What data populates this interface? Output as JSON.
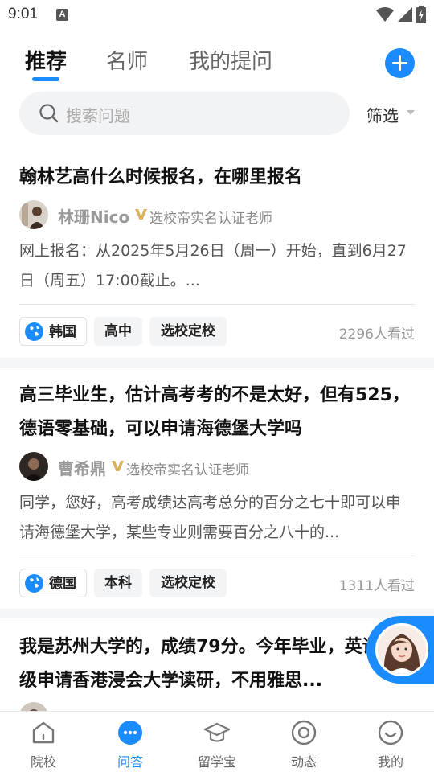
{
  "status_bar": {
    "time": "9:01",
    "notification_badge": "A"
  },
  "tabs": [
    {
      "label": "推荐",
      "active": true
    },
    {
      "label": "名师",
      "active": false
    },
    {
      "label": "我的提问",
      "active": false
    }
  ],
  "search": {
    "placeholder": "搜索问题",
    "filter_label": "筛选"
  },
  "questions": [
    {
      "title": "翰林艺高什么时候报名，在哪里报名",
      "author": "林珊Nico",
      "verified_label": "选校帝实名认证老师",
      "answer": "网上报名：从2025年5月26日（周一）开始，直到6月27日（周五）17:00截止。...",
      "tags": [
        "韩国",
        "高中",
        "选校定校"
      ],
      "views": "2296人看过"
    },
    {
      "title": "高三毕业生，估计高考考的不是太好，但有525，德语零基础，可以申请海德堡大学吗",
      "author": "曹希鼎",
      "verified_label": "选校帝实名认证老师",
      "answer": "同学，您好，高考成绩达高考总分的百分之七十即可以申请海德堡大学，某些专业则需要百分之八十的...",
      "tags": [
        "德国",
        "本科",
        "选校定校"
      ],
      "views": "1311人看过"
    },
    {
      "title": "我是苏州大学的，成绩79分。今年毕业，英语六级申请香港浸会大学读研，不用雅思..."
    }
  ],
  "bottom_nav": [
    {
      "label": "院校",
      "icon": "home-icon",
      "active": false
    },
    {
      "label": "问答",
      "icon": "chat-bubble-icon",
      "active": true
    },
    {
      "label": "留学宝",
      "icon": "graduation-cap-icon",
      "active": false
    },
    {
      "label": "动态",
      "icon": "target-icon",
      "active": false
    },
    {
      "label": "我的",
      "icon": "smile-icon",
      "active": false
    }
  ],
  "colors": {
    "accent": "#1a8cff",
    "verified": "#d9b25a"
  }
}
